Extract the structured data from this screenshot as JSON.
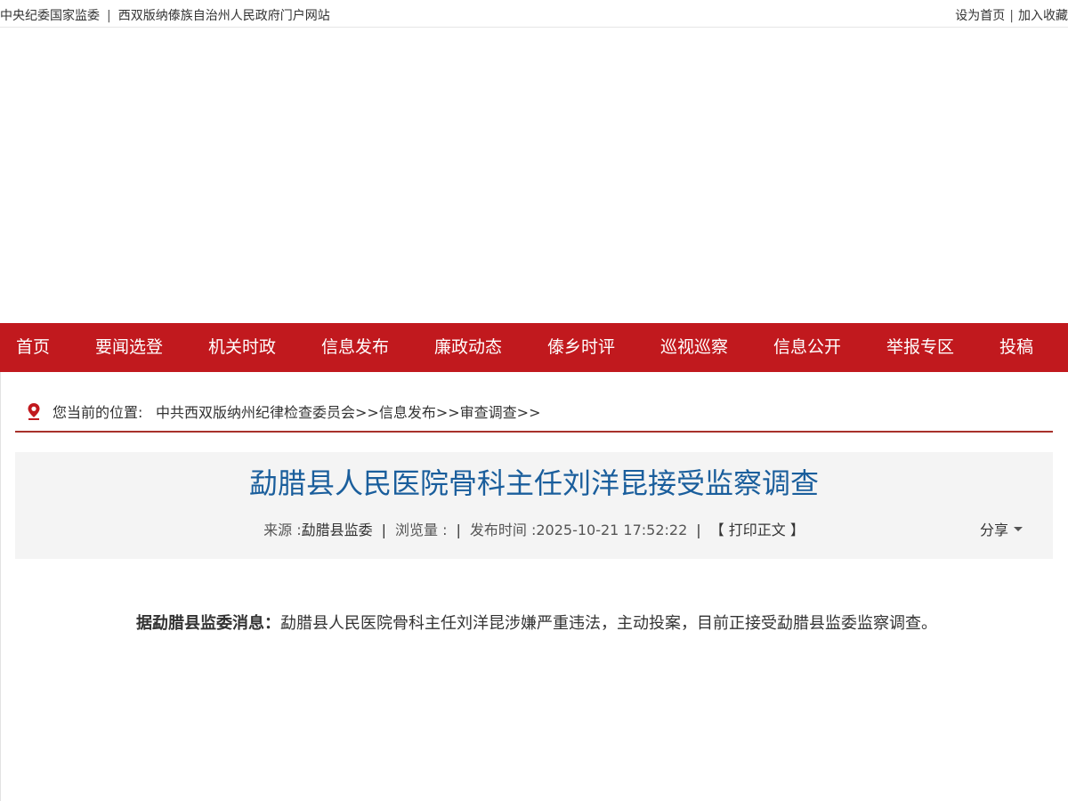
{
  "topbar": {
    "left_links": [
      "中央纪委国家监委",
      "西双版纳傣族自治州人民政府门户网站"
    ],
    "left_sep": "|",
    "right_links": [
      "设为首页",
      "加入收藏"
    ],
    "right_sep": "|"
  },
  "nav": {
    "items": [
      "首页",
      "要闻选登",
      "机关时政",
      "信息发布",
      "廉政动态",
      "傣乡时评",
      "巡视巡察",
      "信息公开",
      "举报专区",
      "投稿"
    ]
  },
  "breadcrumb": {
    "label": "您当前的位置:",
    "path": [
      "中共西双版纳州纪律检查委员会",
      ">>",
      "信息发布",
      ">>",
      "审查调查",
      ">>"
    ]
  },
  "article": {
    "title": "勐腊县人民医院骨科主任刘洋昆接受监察调查",
    "meta": {
      "source_label": "来源 :",
      "source_value": "勐腊县监委",
      "sep": "|",
      "views_label": "浏览量 :",
      "views_value": "",
      "time_label": "发布时间 :",
      "time_value": "2025-10-21 17:52:22",
      "print_label": "【 打印正文 】"
    },
    "share_label": "分享",
    "lead": "据勐腊县监委消息：",
    "body": "勐腊县人民医院骨科主任刘洋昆涉嫌严重违法，主动投案，目前正接受勐腊县监委监察调查。"
  },
  "colors": {
    "nav_bg": "#c1191e",
    "title": "#1a5e9c",
    "crumb_line": "#a8312b",
    "pin": "#c1191e"
  }
}
